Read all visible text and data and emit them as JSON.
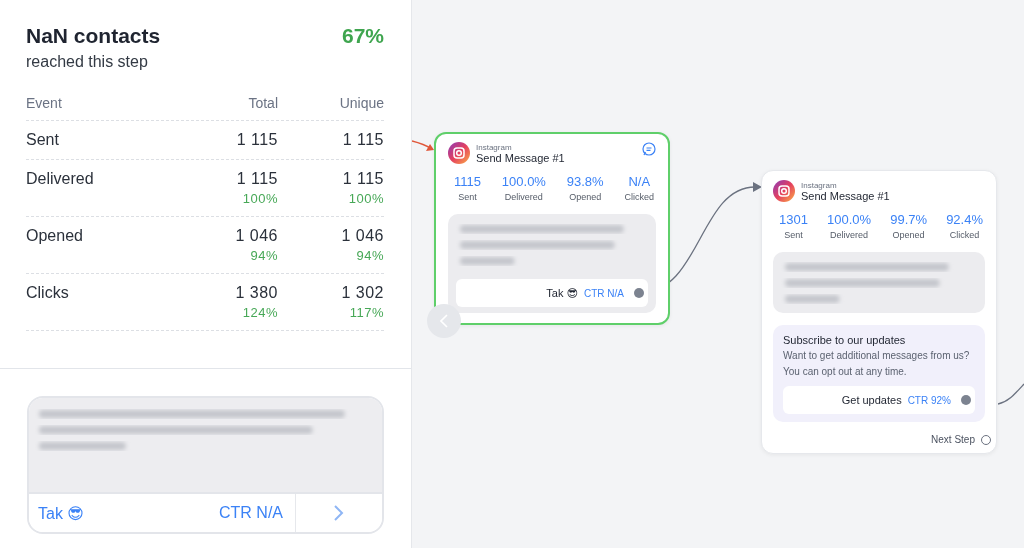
{
  "summary": {
    "title": "NaN contacts",
    "subtitle": "reached this step",
    "percent": "67%"
  },
  "table": {
    "columns": [
      "Event",
      "Total",
      "Unique"
    ],
    "rows": [
      {
        "event": "Sent",
        "total": "1 115",
        "unique": "1 115"
      },
      {
        "event": "Delivered",
        "total": "1 115",
        "total_pct": "100%",
        "unique": "1 115",
        "unique_pct": "100%"
      },
      {
        "event": "Opened",
        "total": "1 046",
        "total_pct": "94%",
        "unique": "1 046",
        "unique_pct": "94%"
      },
      {
        "event": "Clicks",
        "total": "1 380",
        "total_pct": "124%",
        "unique": "1 302",
        "unique_pct": "117%"
      }
    ]
  },
  "message_preview": {
    "button_label": "Tak 😎",
    "ctr": "CTR N/A"
  },
  "nodes": [
    {
      "channel": "Instagram",
      "title": "Send Message #1",
      "selected": true,
      "comment": true,
      "stats": [
        {
          "value": "1115",
          "label": "Sent"
        },
        {
          "value": "100.0%",
          "label": "Delivered"
        },
        {
          "value": "93.8%",
          "label": "Opened"
        },
        {
          "value": "N/A",
          "label": "Clicked"
        }
      ],
      "blocks": [
        {
          "kind": "message",
          "buttons": [
            {
              "label": "Tak 😎",
              "ctr": "CTR N/A"
            }
          ]
        }
      ]
    },
    {
      "channel": "Instagram",
      "title": "Send Message #1",
      "selected": false,
      "comment": false,
      "stats": [
        {
          "value": "1301",
          "label": "Sent"
        },
        {
          "value": "100.0%",
          "label": "Delivered"
        },
        {
          "value": "99.7%",
          "label": "Opened"
        },
        {
          "value": "92.4%",
          "label": "Clicked"
        }
      ],
      "blocks": [
        {
          "kind": "message"
        },
        {
          "kind": "card",
          "title": "Subscribe to our updates",
          "text": "Want to get additional messages from us? You can opt out at any time.",
          "buttons": [
            {
              "label": "Get updates",
              "ctr": "CTR 92%"
            }
          ]
        }
      ],
      "next_step": "Next Step"
    }
  ]
}
